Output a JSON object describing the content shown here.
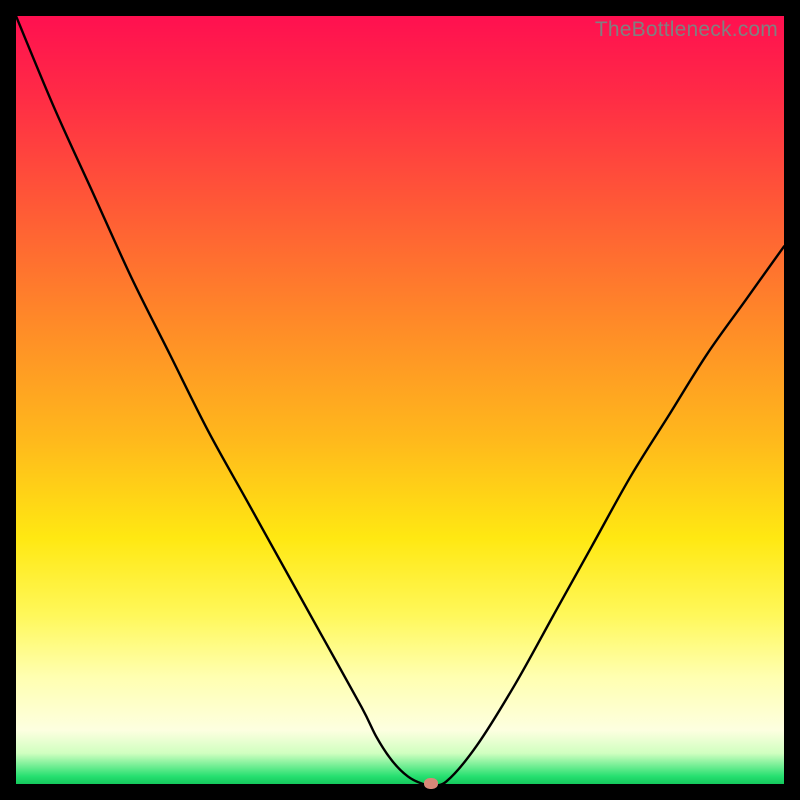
{
  "watermark": "TheBottleneck.com",
  "colors": {
    "frame": "#000000",
    "gradient_top": "#ff1050",
    "gradient_mid": "#ffe812",
    "gradient_bottom": "#14c85c",
    "curve": "#000000",
    "marker": "#d88878",
    "watermark": "#808080"
  },
  "chart_data": {
    "type": "line",
    "title": "",
    "xlabel": "",
    "ylabel": "",
    "xlim": [
      0,
      100
    ],
    "ylim": [
      0,
      100
    ],
    "annotations": [
      "TheBottleneck.com"
    ],
    "x": [
      0,
      5,
      10,
      15,
      20,
      25,
      30,
      35,
      40,
      45,
      47,
      49,
      51,
      53,
      54,
      56,
      60,
      65,
      70,
      75,
      80,
      85,
      90,
      95,
      100
    ],
    "values": [
      100,
      88,
      77,
      66,
      56,
      46,
      37,
      28,
      19,
      10,
      6,
      3,
      1,
      0,
      0,
      0.3,
      5,
      13,
      22,
      31,
      40,
      48,
      56,
      63,
      70
    ],
    "note": "V-shaped bottleneck curve; minimum near x≈54 at y≈0. Values estimated from pixel positions.",
    "marker": {
      "x": 54,
      "y": 0
    }
  }
}
